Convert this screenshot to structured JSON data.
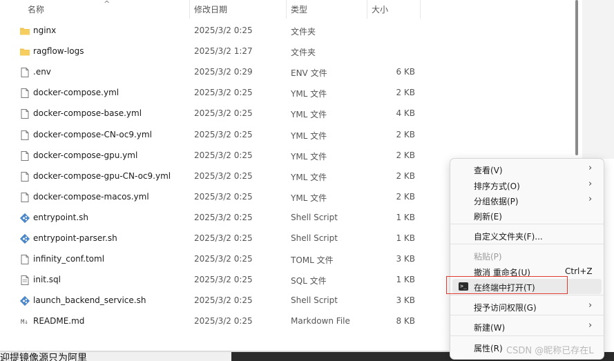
{
  "header": {
    "name": "名称",
    "modified": "修改日期",
    "type": "类型",
    "size": "大小",
    "sort_arrow": "^"
  },
  "files": [
    {
      "name": "nginx",
      "date": "2025/3/2 0:25",
      "type": "文件夹",
      "size": "",
      "icon": "folder-icon"
    },
    {
      "name": "ragflow-logs",
      "date": "2025/3/2 1:27",
      "type": "文件夹",
      "size": "",
      "icon": "folder-icon"
    },
    {
      "name": ".env",
      "date": "2025/3/2 0:29",
      "type": "ENV 文件",
      "size": "6 KB",
      "icon": "file-icon"
    },
    {
      "name": "docker-compose.yml",
      "date": "2025/3/2 0:25",
      "type": "YML 文件",
      "size": "2 KB",
      "icon": "file-icon"
    },
    {
      "name": "docker-compose-base.yml",
      "date": "2025/3/2 0:25",
      "type": "YML 文件",
      "size": "4 KB",
      "icon": "file-icon"
    },
    {
      "name": "docker-compose-CN-oc9.yml",
      "date": "2025/3/2 0:25",
      "type": "YML 文件",
      "size": "2 KB",
      "icon": "file-icon"
    },
    {
      "name": "docker-compose-gpu.yml",
      "date": "2025/3/2 0:25",
      "type": "YML 文件",
      "size": "2 KB",
      "icon": "file-icon"
    },
    {
      "name": "docker-compose-gpu-CN-oc9.yml",
      "date": "2025/3/2 0:25",
      "type": "YML 文件",
      "size": "2 KB",
      "icon": "file-icon"
    },
    {
      "name": "docker-compose-macos.yml",
      "date": "2025/3/2 0:25",
      "type": "YML 文件",
      "size": "2 KB",
      "icon": "file-icon"
    },
    {
      "name": "entrypoint.sh",
      "date": "2025/3/2 0:25",
      "type": "Shell Script",
      "size": "1 KB",
      "icon": "git-icon"
    },
    {
      "name": "entrypoint-parser.sh",
      "date": "2025/3/2 0:25",
      "type": "Shell Script",
      "size": "1 KB",
      "icon": "git-icon"
    },
    {
      "name": "infinity_conf.toml",
      "date": "2025/3/2 0:25",
      "type": "TOML 文件",
      "size": "3 KB",
      "icon": "file-icon"
    },
    {
      "name": "init.sql",
      "date": "2025/3/2 0:25",
      "type": "SQL 文件",
      "size": "1 KB",
      "icon": "sql-file-icon"
    },
    {
      "name": "launch_backend_service.sh",
      "date": "2025/3/2 0:25",
      "type": "Shell Script",
      "size": "3 KB",
      "icon": "git-icon"
    },
    {
      "name": "README.md",
      "date": "2025/3/2 0:25",
      "type": "Markdown File",
      "size": "8 KB",
      "icon": "markdown-icon"
    }
  ],
  "context_menu": {
    "items": [
      {
        "label": "查看(V)",
        "submenu": true
      },
      {
        "label": "排序方式(O)",
        "submenu": true
      },
      {
        "label": "分组依据(P)",
        "submenu": true
      },
      {
        "label": "刷新(E)",
        "submenu": false
      },
      {
        "label": "自定义文件夹(F)...",
        "submenu": false
      },
      {
        "label": "粘贴(P)",
        "submenu": false,
        "disabled": true
      },
      {
        "label": "撤消 重命名(U)",
        "submenu": false,
        "shortcut": "Ctrl+Z"
      },
      {
        "label": "在终端中打开(T)",
        "submenu": false,
        "highlighted": true,
        "icon": "terminal-icon"
      },
      {
        "label": "授予访问权限(G)",
        "submenu": true
      },
      {
        "label": "新建(W)",
        "submenu": true
      },
      {
        "label": "属性(R)",
        "submenu": false
      }
    ],
    "submenu_glyph": "›",
    "terminal_glyph": ">_"
  },
  "bottom_text": "迎提镜像源只为阿里",
  "watermark": "CSDN @昵称已存在L",
  "colors": {
    "highlight_border": "#e23a2f",
    "folder": "#f2c14e",
    "git_blue": "#4a86c8"
  }
}
